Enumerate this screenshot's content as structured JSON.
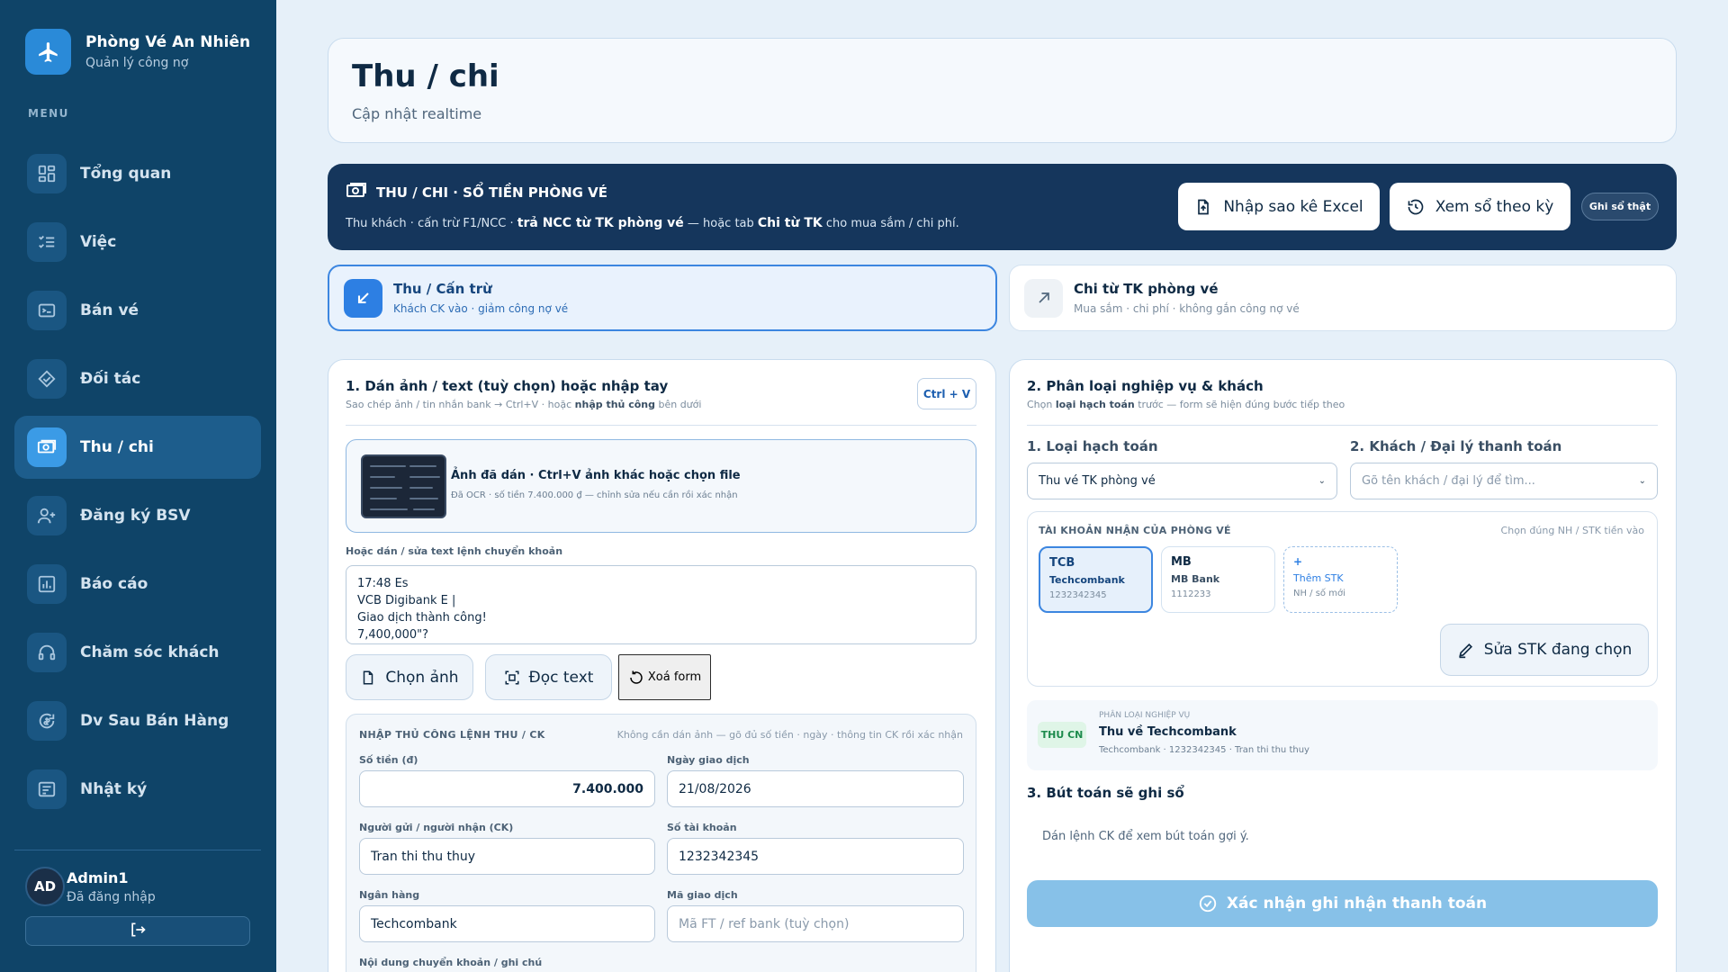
{
  "brand": {
    "name": "Phòng Vé An Nhiên",
    "subtitle": "Quản lý công nợ"
  },
  "menu_label": "MENU",
  "nav": [
    {
      "label": "Tổng quan",
      "icon": "dashboard-icon"
    },
    {
      "label": "Việc",
      "icon": "checklist-icon"
    },
    {
      "label": "Bán vé",
      "icon": "ticket-icon"
    },
    {
      "label": "Đối tác",
      "icon": "handshake-icon"
    },
    {
      "label": "Thu / chi",
      "icon": "money-icon",
      "active": true
    },
    {
      "label": "Đăng ký BSV",
      "icon": "user-plus-icon"
    },
    {
      "label": "Báo cáo",
      "icon": "report-icon"
    },
    {
      "label": "Chăm sóc khách",
      "icon": "support-icon"
    },
    {
      "label": "Dv Sau Bán Hàng",
      "icon": "refresh-dollar-icon"
    },
    {
      "label": "Nhật ký",
      "icon": "log-icon"
    }
  ],
  "user": {
    "initials": "AD",
    "name": "Admin1",
    "status": "Đã đăng nhập"
  },
  "header": {
    "title": "Thu / chi",
    "subtitle": "Cập nhật realtime"
  },
  "banner": {
    "title": "THU / CHI · SỔ TIỀN PHÒNG VÉ",
    "desc_1": "Thu khách · cấn trừ F1/NCC · ",
    "desc_2": "trả NCC từ TK phòng vé",
    "desc_3": " — hoặc tab ",
    "desc_4": "Chi từ TK",
    "desc_5": " cho mua sắm / chi phí.",
    "import_label": "Nhập sao kê Excel",
    "ledger_label": "Xem sổ theo kỳ",
    "ghi_label": "Ghi sổ thật"
  },
  "tabs": {
    "in": {
      "title": "Thu / Cấn trừ",
      "subtitle": "Khách CK vào · giảm công nợ vé"
    },
    "out": {
      "title": "Chi từ TK phòng vé",
      "subtitle": "Mua sắm · chi phí · không gắn công nợ vé"
    }
  },
  "left": {
    "title": "1. Dán ảnh / text (tuỳ chọn) hoặc nhập tay",
    "sub_1": "Sao chép ảnh / tin nhắn bank → Ctrl+V · hoặc ",
    "sub_2": "nhập thủ công",
    "sub_3": " bên dưới",
    "kbd": "Ctrl + V",
    "paste_title": "Ảnh đã dán · Ctrl+V ảnh khác hoặc chọn file",
    "paste_sub": "Đã OCR · số tiền 7.400.000 ₫ — chỉnh sửa nếu cần rồi xác nhận",
    "text_label": "Hoặc dán / sửa text lệnh chuyển khoản",
    "text_value": "17:48 Es\nVCB Digibank E |\nGiao dịch thành công!\n7,400,000\"?",
    "btn_choose": "Chọn ảnh",
    "btn_read": "Đọc text",
    "btn_clear": "Xoá form",
    "manual": {
      "title": "NHẬP THỦ CÔNG LỆNH THU / CK",
      "hint": "Không cần dán ảnh — gõ đủ số tiền · ngày · thông tin CK rồi xác nhận",
      "amount_label": "Số tiền (đ)",
      "amount_value": "7.400.000",
      "date_label": "Ngày giao dịch",
      "date_value": "21/08/2026",
      "sender_label": "Người gửi / người nhận (CK)",
      "sender_value": "Tran thi thu thuy",
      "account_label": "Số tài khoản",
      "account_value": "1232342345",
      "bank_label": "Ngân hàng",
      "bank_value": "Techcombank",
      "ref_label": "Mã giao dịch",
      "ref_placeholder": "Mã FT / ref bank (tuỳ chọn)",
      "note_label": "Nội dung chuyển khoản / ghi chú"
    }
  },
  "right": {
    "title": "2. Phân loại nghiệp vụ & khách",
    "sub_1": "Chọn ",
    "sub_2": "loại hạch toán",
    "sub_3": " trước — form sẽ hiện đúng bước tiếp theo",
    "type_label": "1. Loại hạch toán",
    "type_value": "Thu vé TK phòng vé",
    "customer_label": "2. Khách / Đại lý thanh toán",
    "customer_placeholder": "Gõ tên khách / đại lý để tìm...",
    "accounts_head": "TÀI KHOẢN NHẬN CỦA PHÒNG VÉ",
    "accounts_hint": "Chọn đúng NH / STK tiền vào",
    "accounts": [
      {
        "code": "TCB",
        "name": "Techcombank",
        "number": "1232342345"
      },
      {
        "code": "MB",
        "name": "MB Bank",
        "number": "1112233"
      }
    ],
    "add_account": {
      "plus": "+",
      "label": "Thêm STK",
      "sub": "NH / số mới"
    },
    "edit_label": "Sửa STK đang chọn",
    "class_badge": "THU CN",
    "class_caption": "PHÂN LOẠI NGHIỆP VỤ",
    "class_title": "Thu về Techcombank",
    "class_sub": "Techcombank · 1232342345 · Tran thi thu thuy",
    "journal_title": "3. Bút toán sẽ ghi sổ",
    "journal_hint": "Dán lệnh CK để xem bút toán gợi ý.",
    "confirm_label": "Xác nhận ghi nhận thanh toán"
  },
  "colors": {
    "sidebar": "#0f4468",
    "accent": "#2d7fe3",
    "banner": "#15365c",
    "confirm": "#87c1e8"
  }
}
